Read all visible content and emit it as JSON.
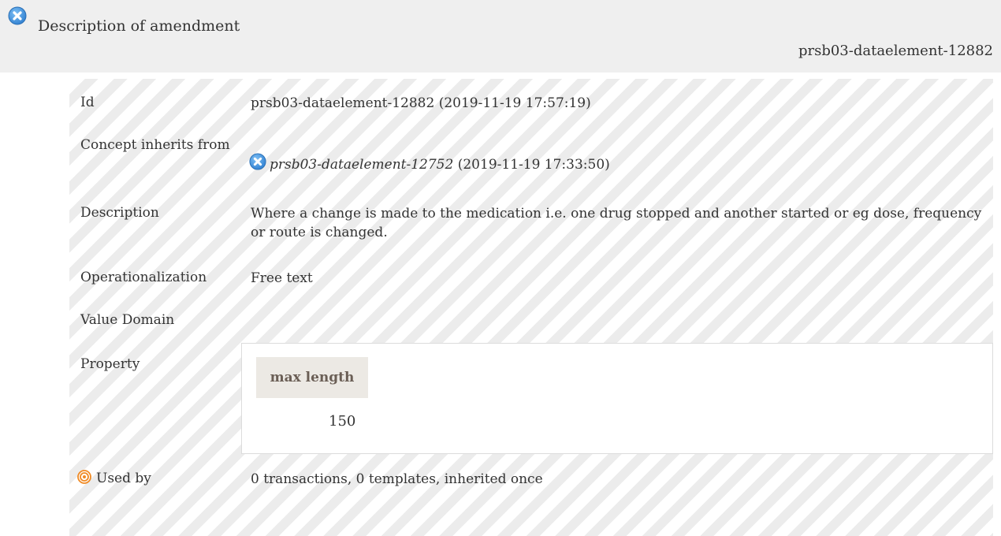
{
  "header": {
    "title": "Description of amendment",
    "id_label": "prsb03-dataelement-12882"
  },
  "icons": {
    "header": "close-circle-icon",
    "inherits": "close-circle-icon",
    "used_by": "target-icon"
  },
  "rows": {
    "id": {
      "label": "Id",
      "value": "prsb03-dataelement-12882 (2019-11-19 17:57:19)"
    },
    "inherits": {
      "label": "Concept inherits from",
      "ref_id": "prsb03-dataelement-12752",
      "ref_date": "(2019-11-19 17:33:50)"
    },
    "description": {
      "label": "Description",
      "value": "Where a change is made to the medication i.e. one drug stopped and another started or eg dose, frequency or route is changed."
    },
    "operationalization": {
      "label": "Operationalization",
      "value": "Free text"
    },
    "value_domain": {
      "label": "Value Domain"
    },
    "property": {
      "label": "Property",
      "column_header": "max length",
      "column_value": "150"
    },
    "used_by": {
      "label": "Used by",
      "value": "0 transactions, 0 templates, inherited once"
    }
  },
  "colors": {
    "header_bg": "#efefef",
    "icon_blue": "#3b8fd9",
    "target_orange": "#f08a24",
    "property_header_bg": "#ece9e4"
  }
}
